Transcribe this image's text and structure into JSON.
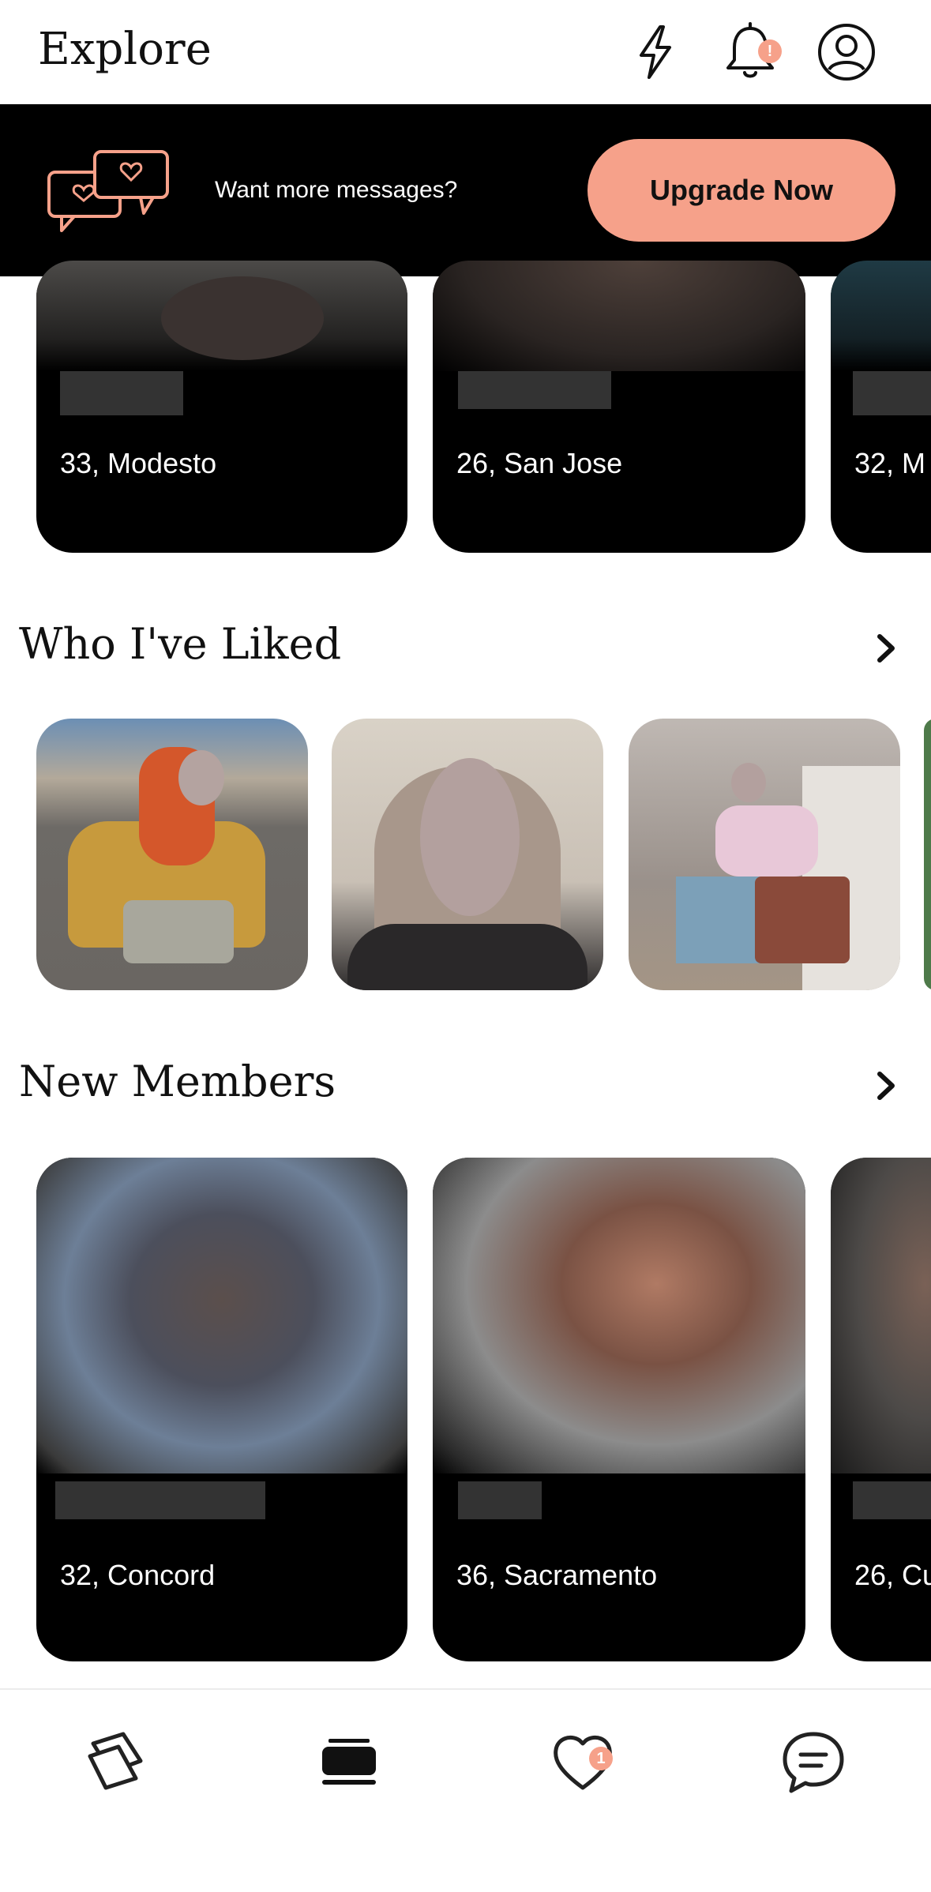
{
  "header": {
    "title": "Explore",
    "icons": [
      "lightning-icon",
      "bell-icon",
      "profile-icon"
    ],
    "notification_badge": "!"
  },
  "promo": {
    "text": "Want more messages?",
    "button_label": "Upgrade Now",
    "accent_color": "#f6a18a"
  },
  "top_cards": [
    {
      "info": "33, Modesto"
    },
    {
      "info": "26, San Jose"
    },
    {
      "info": "32, M"
    }
  ],
  "liked": {
    "title": "Who I've Liked"
  },
  "new_members": {
    "title": "New Members",
    "cards": [
      {
        "info": "32, Concord"
      },
      {
        "info": "36, Sacramento"
      },
      {
        "info": "26, Cu"
      }
    ]
  },
  "bottom_nav": {
    "items": [
      "cards-icon",
      "explore-icon",
      "likes-icon",
      "messages-icon"
    ],
    "likes_badge": "1"
  }
}
